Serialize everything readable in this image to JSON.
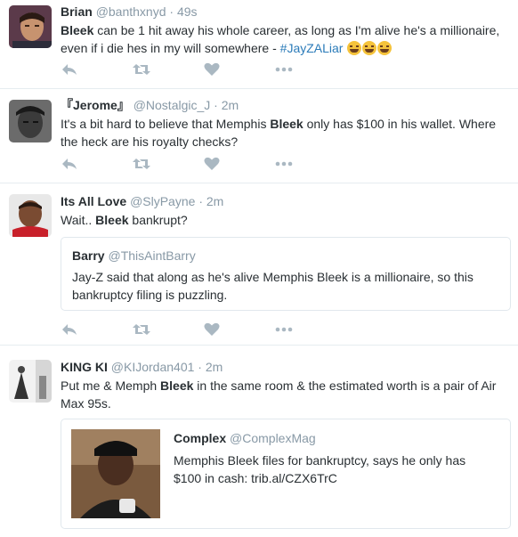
{
  "tweets": [
    {
      "name": "Brian",
      "handle": "@banthxnyd",
      "sep": "·",
      "time": "49s",
      "text_1": "Bleek",
      "text_2": " can be 1 hit away his whole career, as long as I'm alive he's a millionaire, even if i die hes in my will somewhere - ",
      "hashtag": "#JayZALiar",
      "emoji": "face-with-tears-of-joy"
    },
    {
      "name": "『Jerome』",
      "handle": "@Nostalgic_J",
      "sep": "·",
      "time": "2m",
      "text_1": "It's a bit hard to believe that Memphis ",
      "text_2": "Bleek",
      "text_3": " only has $100 in his wallet. Where the heck are his royalty checks?"
    },
    {
      "name": "Its All Love",
      "handle": "@SlyPayne",
      "sep": "·",
      "time": "2m",
      "text_1": "Wait.. ",
      "text_2": "Bleek",
      "text_3": " bankrupt?",
      "quote": {
        "name": "Barry",
        "handle": "@ThisAintBarry",
        "text": "Jay-Z said that along as he's alive Memphis Bleek is a millionaire, so this bankruptcy filing is puzzling."
      }
    },
    {
      "name": "KING KI",
      "handle": "@KIJordan401",
      "sep": "·",
      "time": "2m",
      "text_1": "Put me & Memph ",
      "text_2": "Bleek",
      "text_3": " in the same room & the estimated worth is a pair of Air Max 95s.",
      "quote": {
        "name": "Complex",
        "handle": "@ComplexMag",
        "text": "Memphis Bleek files for bankruptcy, says he only has $100 in cash: trib.al/CZX6TrC"
      }
    }
  ],
  "actions": [
    "reply-icon",
    "retweet-icon",
    "like-icon",
    "more-icon"
  ],
  "colors": {
    "name": "#292f33",
    "meta": "#8899a6",
    "hashtag": "#2b7bb9",
    "icon": "#aab8c2",
    "border": "#e1e8ed"
  }
}
